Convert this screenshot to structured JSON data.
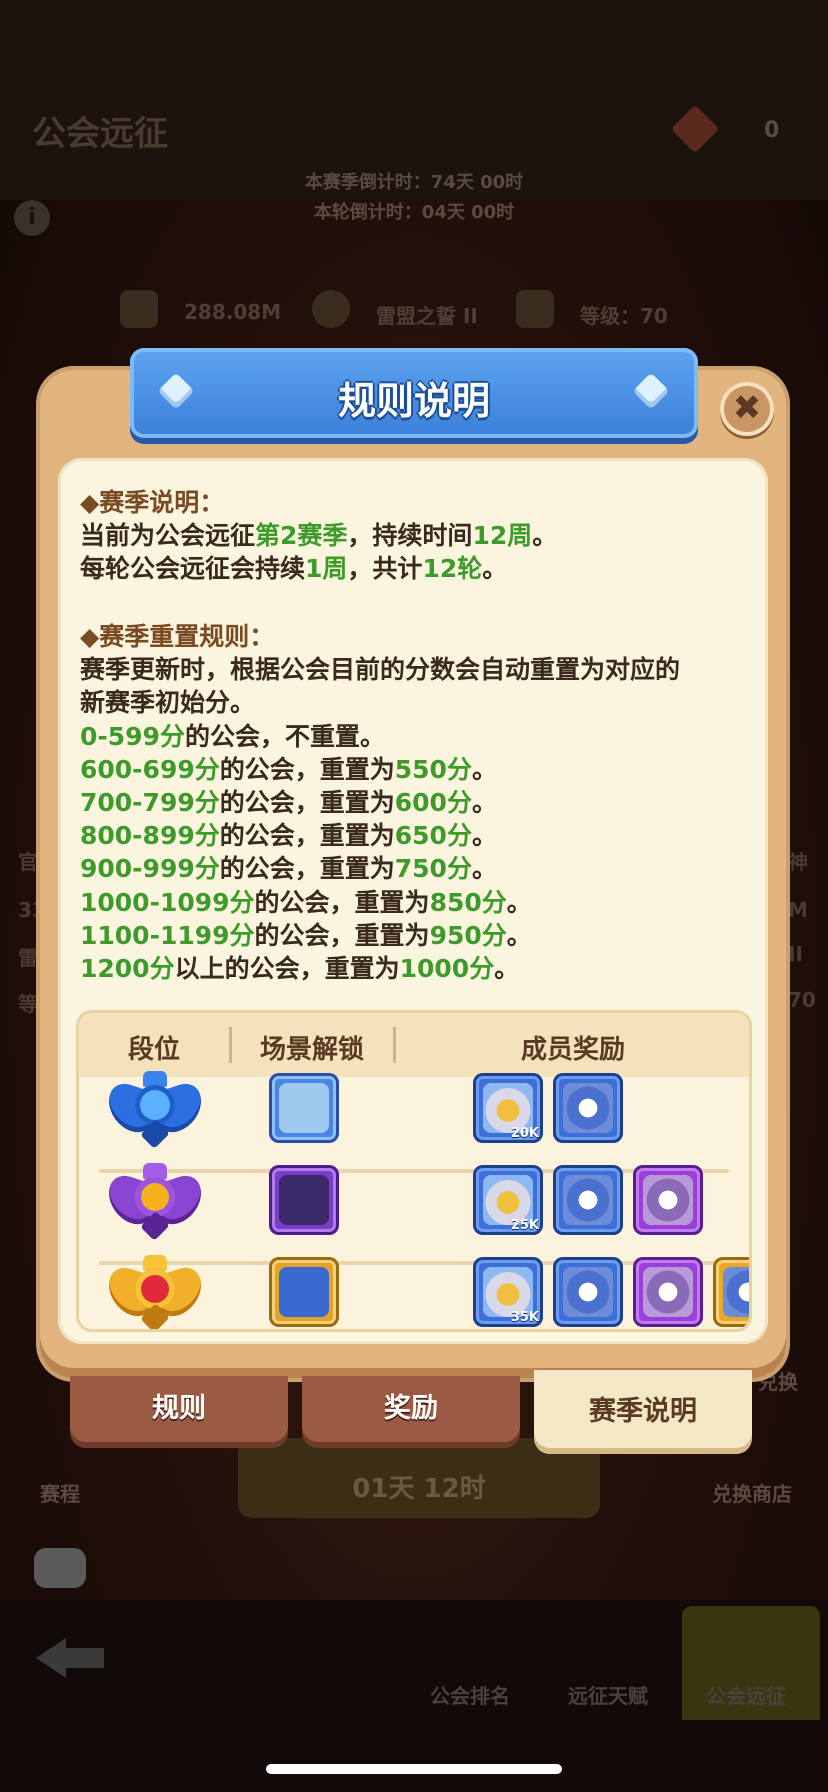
{
  "background": {
    "title": "公会远征",
    "gem_count": "0",
    "season_countdown": "本赛季倒计时：74天 00时",
    "round_countdown": "本轮倒计时：04天 00时",
    "stat_power": "288.08M",
    "stat_guild": "雷盟之誓 II",
    "stat_level": "等级：70",
    "side_left": [
      "官",
      "33",
      "雷",
      "等"
    ],
    "side_right": [
      "神",
      "M",
      "II",
      "70"
    ],
    "lower_left_label": "赛程",
    "lower_right_label": "兑换商店",
    "lower_right_top": "兑换",
    "timer_pill": "01天 12时",
    "nav": [
      "公会排名",
      "远征天赋",
      "公会远征"
    ]
  },
  "dialog": {
    "title": "规则说明",
    "close_label": "✖",
    "season_section": {
      "heading": "◆赛季说明：",
      "line1": {
        "a": "当前为公会远征",
        "b": "第2赛季",
        "c": "，持续时间",
        "d": "12周",
        "e": "。"
      },
      "line2": {
        "a": "每轮公会远征会持续",
        "b": "1周",
        "c": "，共计",
        "d": "12轮",
        "e": "。"
      }
    },
    "reset_section": {
      "heading": "◆赛季重置规则：",
      "intro1": "赛季更新时，根据公会目前的分数会自动重置为对应的",
      "intro2": "新赛季初始分。",
      "rules": [
        {
          "range": "0-599分",
          "text": "的公会，不重置。",
          "value": "",
          "end": ""
        },
        {
          "range": "600-699分",
          "text": "的公会，重置为",
          "value": "550分",
          "end": "。"
        },
        {
          "range": "700-799分",
          "text": "的公会，重置为",
          "value": "600分",
          "end": "。"
        },
        {
          "range": "800-899分",
          "text": "的公会，重置为",
          "value": "650分",
          "end": "。"
        },
        {
          "range": "900-999分",
          "text": "的公会，重置为",
          "value": "750分",
          "end": "。"
        },
        {
          "range": "1000-1099分",
          "text": "的公会，重置为",
          "value": "850分",
          "end": "。"
        },
        {
          "range": "1100-1199分",
          "text": "的公会，重置为",
          "value": "950分",
          "end": "。"
        },
        {
          "range": "1200分",
          "text": "以上的公会，重置为",
          "value": "1000分",
          "end": "。"
        }
      ]
    },
    "table": {
      "headers": [
        "段位",
        "场景解锁",
        "成员奖励"
      ],
      "rows": [
        {
          "rank": "blue-rank-emblem",
          "scene": "blue-scene-tile",
          "rewards": [
            "20K",
            ""
          ]
        },
        {
          "rank": "purple-rank-emblem",
          "scene": "purple-scene-tile",
          "rewards": [
            "25K",
            "",
            ""
          ]
        },
        {
          "rank": "gold-rank-emblem",
          "scene": "gold-scene-tile",
          "rewards": [
            "35K",
            "",
            "",
            ""
          ]
        }
      ]
    },
    "tabs": [
      {
        "label": "规则",
        "active": false
      },
      {
        "label": "奖励",
        "active": false
      },
      {
        "label": "赛季说明",
        "active": true
      }
    ]
  }
}
